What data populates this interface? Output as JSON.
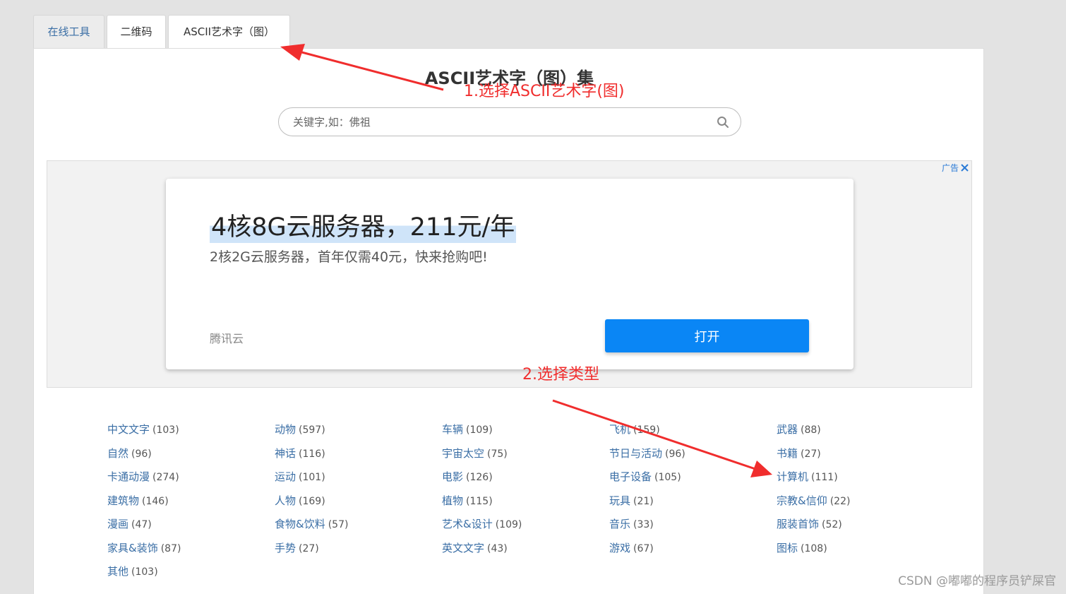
{
  "tabs": [
    {
      "label": "在线工具"
    },
    {
      "label": "二维码"
    },
    {
      "label": "ASCII艺术字（图）"
    }
  ],
  "page_title": "ASCII艺术字（图）集",
  "search": {
    "placeholder": "关键字,如：佛祖",
    "icon": "search-icon"
  },
  "ad": {
    "label": "广告",
    "headline": "4核8G云服务器，211元/年",
    "subtext": "2核2G云服务器，首年仅需40元，快来抢购吧!",
    "brand": "腾讯云",
    "button": "打开",
    "button_color": "#0a86f5"
  },
  "categories": [
    [
      {
        "name": "中文文字",
        "count": "(103)"
      },
      {
        "name": "自然",
        "count": "(96)"
      },
      {
        "name": "卡通动漫",
        "count": "(274)"
      },
      {
        "name": "建筑物",
        "count": "(146)"
      },
      {
        "name": "漫画",
        "count": "(47)"
      },
      {
        "name": "家具&装饰",
        "count": "(87)"
      },
      {
        "name": "其他",
        "count": "(103)"
      }
    ],
    [
      {
        "name": "动物",
        "count": "(597)"
      },
      {
        "name": "神话",
        "count": "(116)"
      },
      {
        "name": "运动",
        "count": "(101)"
      },
      {
        "name": "人物",
        "count": "(169)"
      },
      {
        "name": "食物&饮料",
        "count": "(57)"
      },
      {
        "name": "手势",
        "count": "(27)"
      }
    ],
    [
      {
        "name": "车辆",
        "count": "(109)"
      },
      {
        "name": "宇宙太空",
        "count": "(75)"
      },
      {
        "name": "电影",
        "count": "(126)"
      },
      {
        "name": "植物",
        "count": "(115)"
      },
      {
        "name": "艺术&设计",
        "count": "(109)"
      },
      {
        "name": "英文文字",
        "count": "(43)"
      }
    ],
    [
      {
        "name": "飞机",
        "count": "(159)"
      },
      {
        "name": "节日与活动",
        "count": "(96)"
      },
      {
        "name": "电子设备",
        "count": "(105)"
      },
      {
        "name": "玩具",
        "count": "(21)"
      },
      {
        "name": "音乐",
        "count": "(33)"
      },
      {
        "name": "游戏",
        "count": "(67)"
      }
    ],
    [
      {
        "name": "武器",
        "count": "(88)"
      },
      {
        "name": "书籍",
        "count": "(27)"
      },
      {
        "name": "计算机",
        "count": "(111)"
      },
      {
        "name": "宗教&信仰",
        "count": "(22)"
      },
      {
        "name": "服装首饰",
        "count": "(52)"
      },
      {
        "name": "图标",
        "count": "(108)"
      }
    ]
  ],
  "annotations": {
    "step1": "1.选择ASCII艺术字(图)",
    "step2": "2.选择类型",
    "color": "#f02d2d"
  },
  "watermark": "CSDN @嘟嘟的程序员铲屎官"
}
